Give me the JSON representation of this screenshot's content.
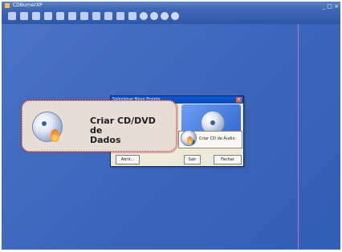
{
  "window": {
    "title": "CDBurnerXP",
    "controls": "_ □ ×"
  },
  "toolbar": {
    "icons": [
      "new-icon",
      "open-icon",
      "save-icon",
      "cut-icon",
      "copy-icon",
      "paste-icon",
      "delete-icon",
      "properties-icon",
      "up-icon",
      "down-icon",
      "burn-icon",
      "erase-icon",
      "help-icon",
      "about-icon",
      "globe-icon",
      "exit-icon"
    ]
  },
  "dialog": {
    "title": "Selecionar Novo Projeto",
    "close": "x",
    "data_option_label": "Criar CD/DVD de\nDados",
    "audio_option_label": "Criar CD de Áudio",
    "buttons": {
      "open_label": "Abrir...",
      "exit_label": "Sair",
      "close_label": "Fechar"
    }
  },
  "colors": {
    "workspace": "#3f69c0",
    "titlebar": "#3f67ad",
    "accent_line": "#e47bb9",
    "dialog_title": "#0a46b4",
    "callout_border": "#c43d3d"
  }
}
